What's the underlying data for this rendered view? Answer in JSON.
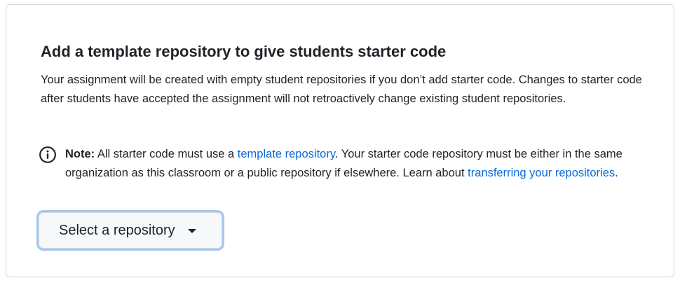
{
  "section": {
    "title": "Add a template repository to give students starter code",
    "description": "Your assignment will be created with empty student repositories if you don’t add starter code. Changes to starter code after students have accepted the assignment will not retroactively change existing student repositories."
  },
  "note": {
    "icon": "info-icon",
    "label": "Note:",
    "text_1": " All starter code must use a ",
    "link_1": "template repository",
    "text_2": ". Your starter code repository must be either in the same organization as this classroom or a public repository if elsewhere. Learn about ",
    "link_2": "transferring your repositories",
    "text_3": "."
  },
  "select": {
    "label": "Select a repository",
    "icon": "caret-down-icon"
  },
  "colors": {
    "link": "#0969da",
    "focus_ring": "#a8c7ef",
    "border": "#d0d7de"
  }
}
